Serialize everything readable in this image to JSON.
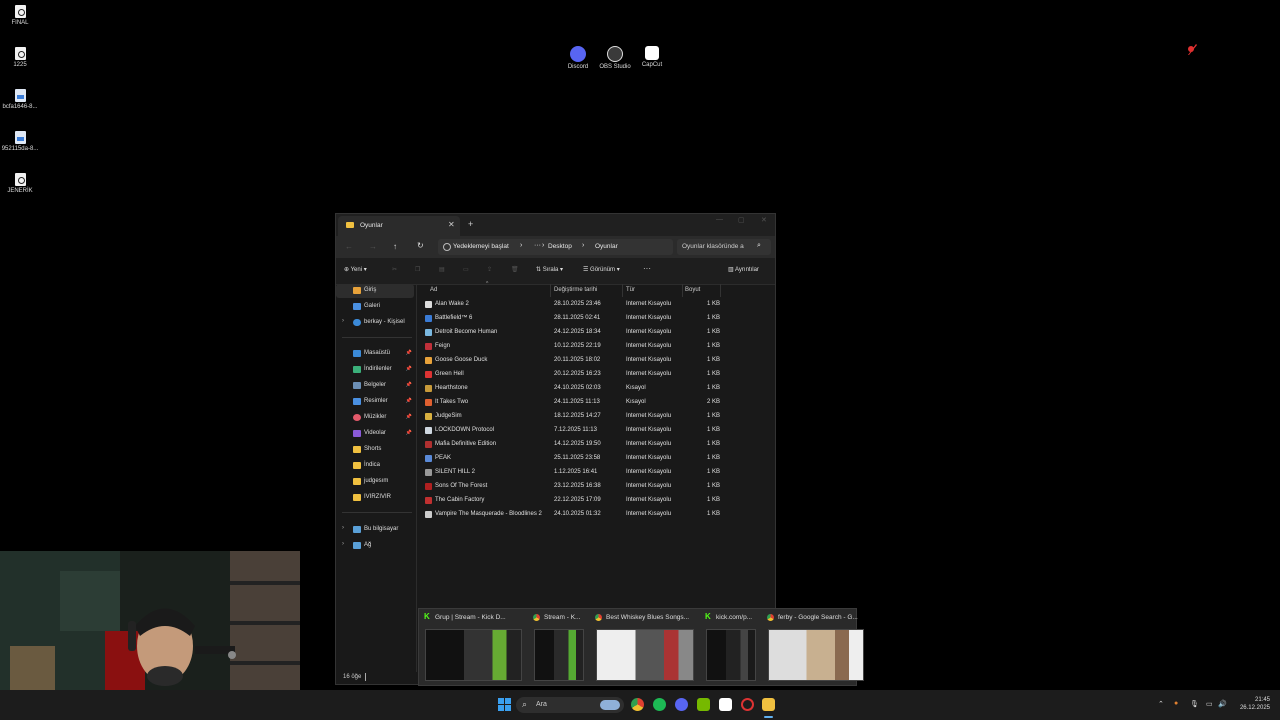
{
  "desktop": {
    "icons": [
      {
        "label": "FINAL",
        "icon": "document-icon"
      },
      {
        "label": "1225",
        "icon": "document-icon"
      },
      {
        "label": "bcfa1646-8...",
        "icon": "image-file-icon"
      },
      {
        "label": "952115da-8...",
        "icon": "image-file-icon"
      },
      {
        "label": "JENERİK",
        "icon": "document-icon"
      }
    ],
    "apps": [
      {
        "label": "Discord",
        "icon": "discord-icon",
        "color": "#5865F2"
      },
      {
        "label": "OBS Studio",
        "icon": "obs-icon",
        "color": "#2a2a2a"
      },
      {
        "label": "CapCut",
        "icon": "capcut-icon",
        "color": "#111111"
      }
    ]
  },
  "explorer": {
    "tab_title": "Oyunlar",
    "address": {
      "backup": "Yedeklemeyi başlat",
      "ellipsis": "···",
      "crumbs": [
        "Desktop",
        "Oyunlar"
      ],
      "search_placeholder": "Oyunlar klasöründe a"
    },
    "toolbar": {
      "new": "Yeni",
      "sort": "Sırala",
      "view": "Görünüm",
      "more": "···",
      "details": "Ayrıntılar"
    },
    "nav": {
      "home": "Giriş",
      "gallery": "Galeri",
      "onedrive": "berkay - Kişisel",
      "quick": [
        {
          "label": "Masaüstü",
          "color": "#3b8ad8"
        },
        {
          "label": "İndirilenler",
          "color": "#3bb07a"
        },
        {
          "label": "Belgeler",
          "color": "#6c8fb5"
        },
        {
          "label": "Resimler",
          "color": "#4a90e2"
        },
        {
          "label": "Müzikler",
          "color": "#e45a6b"
        },
        {
          "label": "Videolar",
          "color": "#8a5ad8"
        }
      ],
      "folders": [
        "Shorts",
        "İndica",
        "judgesım",
        "IVIRZIVIR"
      ],
      "this_pc": "Bu bilgisayar",
      "network": "Ağ"
    },
    "columns": {
      "name": "Ad",
      "date": "Değiştirme tarihi",
      "type": "Tür",
      "size": "Boyut"
    },
    "files": [
      {
        "name": "Alan Wake 2",
        "date": "28.10.2025 23:46",
        "type": "Internet Kısayolu",
        "size": "1 KB",
        "color": "#ddd"
      },
      {
        "name": "Battlefield™ 6",
        "date": "28.11.2025 02:41",
        "type": "Internet Kısayolu",
        "size": "1 KB",
        "color": "#3a7bd5"
      },
      {
        "name": "Detroit Become Human",
        "date": "24.12.2025 18:34",
        "type": "Internet Kısayolu",
        "size": "1 KB",
        "color": "#7ab8e0"
      },
      {
        "name": "Feign",
        "date": "10.12.2025 22:19",
        "type": "Internet Kısayolu",
        "size": "1 KB",
        "color": "#c0303a"
      },
      {
        "name": "Goose Goose Duck",
        "date": "20.11.2025 18:02",
        "type": "Internet Kısayolu",
        "size": "1 KB",
        "color": "#e8a23a"
      },
      {
        "name": "Green Hell",
        "date": "20.12.2025 16:23",
        "type": "Internet Kısayolu",
        "size": "1 KB",
        "color": "#d33"
      },
      {
        "name": "Hearthstone",
        "date": "24.10.2025 02:03",
        "type": "Kısayol",
        "size": "1 KB",
        "color": "#c79a3a"
      },
      {
        "name": "It Takes Two",
        "date": "24.11.2025 11:13",
        "type": "Kısayol",
        "size": "2 KB",
        "color": "#e06030"
      },
      {
        "name": "JudgeSim",
        "date": "18.12.2025 14:27",
        "type": "Internet Kısayolu",
        "size": "1 KB",
        "color": "#d8b040"
      },
      {
        "name": "LOCKDOWN Protocol",
        "date": "7.12.2025 11:13",
        "type": "Internet Kısayolu",
        "size": "1 KB",
        "color": "#cfd8e0"
      },
      {
        "name": "Mafia Definitive Edition",
        "date": "14.12.2025 19:50",
        "type": "Internet Kısayolu",
        "size": "1 KB",
        "color": "#b03030"
      },
      {
        "name": "PEAK",
        "date": "25.11.2025 23:58",
        "type": "Internet Kısayolu",
        "size": "1 KB",
        "color": "#5a8ad8"
      },
      {
        "name": "SILENT HILL 2",
        "date": "1.12.2025 16:41",
        "type": "Internet Kısayolu",
        "size": "1 KB",
        "color": "#999"
      },
      {
        "name": "Sons Of The Forest",
        "date": "23.12.2025 16:38",
        "type": "Internet Kısayolu",
        "size": "1 KB",
        "color": "#b02020"
      },
      {
        "name": "The Cabin Factory",
        "date": "22.12.2025 17:09",
        "type": "Internet Kısayolu",
        "size": "1 KB",
        "color": "#c03030"
      },
      {
        "name": "Vampire The Masquerade - Bloodlines 2",
        "date": "24.10.2025 01:32",
        "type": "Internet Kısayolu",
        "size": "1 KB",
        "color": "#ccc"
      }
    ],
    "status": "16 öğe"
  },
  "thumbnails": [
    {
      "title": "Grup | Stream - Kick D...",
      "icon": "kick-icon",
      "color": "#53fc18"
    },
    {
      "title": "Stream - K...",
      "icon": "chrome-icon",
      "color": "#e8b53a"
    },
    {
      "title": "Best Whiskey Blues Songs...",
      "icon": "chrome-icon",
      "color": "#e8b53a"
    },
    {
      "title": "kick.com/p...",
      "icon": "kick-icon",
      "color": "#53fc18"
    },
    {
      "title": "ferby - Google Search - G...",
      "icon": "chrome-icon",
      "color": "#e8b53a"
    }
  ],
  "taskbar": {
    "search_placeholder": "Ara",
    "clock_time": "21:45",
    "clock_date": "26.12.2025"
  }
}
